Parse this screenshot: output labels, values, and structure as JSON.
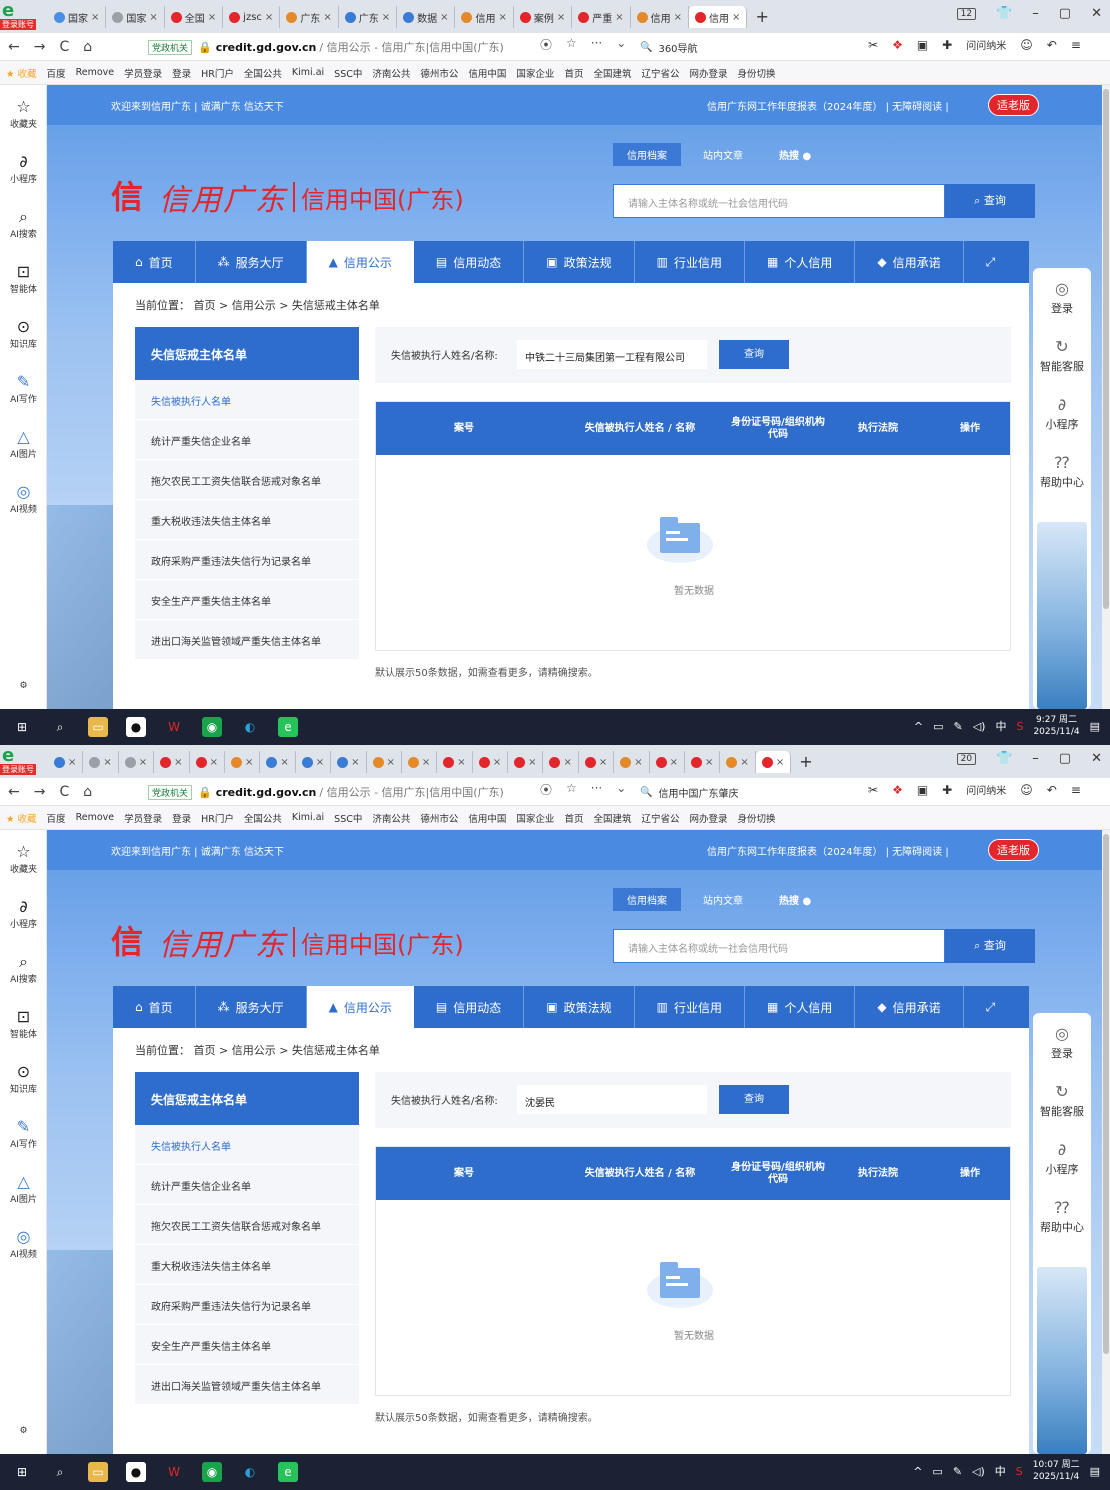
{
  "screenshots": [
    {
      "browser": {
        "logo_icon": "browser-logo",
        "account_badge": "登录账号",
        "tabs": [
          {
            "label": "国家",
            "active": false,
            "color": "#4a90e2"
          },
          {
            "label": "国家",
            "active": false,
            "color": "#9aa0a6"
          },
          {
            "label": "全国",
            "active": false,
            "color": "#e3262b"
          },
          {
            "label": "jzsc",
            "active": false,
            "color": "#e3262b"
          },
          {
            "label": "广东",
            "active": false,
            "color": "#e58a2b"
          },
          {
            "label": "广东",
            "active": false,
            "color": "#3a7bd5"
          },
          {
            "label": "数据",
            "active": false,
            "color": "#3a7bd5"
          },
          {
            "label": "信用",
            "active": false,
            "color": "#e58a2b"
          },
          {
            "label": "案例",
            "active": false,
            "color": "#e3262b"
          },
          {
            "label": "严重",
            "active": false,
            "color": "#e3262b"
          },
          {
            "label": "信用",
            "active": false,
            "color": "#e58a2b"
          },
          {
            "label": "信用",
            "active": true,
            "color": "#e3262b"
          }
        ],
        "new_tab": "+",
        "tab_count": "12",
        "url_org_tag": "党政机关",
        "url_domain": "credit.gd.gov.cn",
        "url_path": "/ 信用公示 - 信用广东|信用中国(广东)",
        "search_text": "360导航",
        "wenwen": "问问纳米",
        "bookmarks": [
          "收藏",
          "百度",
          "Remove",
          "学员登录",
          "登录",
          "HR门户",
          "全国公共",
          "Kimi.ai",
          "SSC中",
          "济南公共",
          "德州市公",
          "信用中国",
          "国家企业",
          "首页",
          "全国建筑",
          "辽宁省公",
          "网办登录",
          "身份切换"
        ]
      },
      "sidebar": [
        {
          "label": "收藏夹",
          "icon": "star-icon"
        },
        {
          "label": "小程序",
          "icon": "miniapp-icon"
        },
        {
          "label": "AI搜索",
          "icon": "search-icon"
        },
        {
          "label": "智能体",
          "icon": "agent-icon"
        },
        {
          "label": "知识库",
          "icon": "knowledge-icon"
        },
        {
          "label": "AI写作",
          "icon": "write-icon"
        },
        {
          "label": "AI图片",
          "icon": "image-icon"
        },
        {
          "label": "AI视频",
          "icon": "video-icon"
        }
      ],
      "site": {
        "welcome": "欢迎来到信用广东 | 诚满广东 信达天下",
        "annual_report": "信用广东网工作年度报表（2024年度） | 无障碍阅读 |",
        "elder_mode": "适老版",
        "logo_script": "信用广东",
        "logo_cn": "信用中国(广东)",
        "search_filters": [
          "信用档案",
          "站内文章",
          "热搜"
        ],
        "search_placeholder": "请输入主体名称或统一社会信用代码",
        "search_button": "查询",
        "nav": [
          "首页",
          "服务大厅",
          "信用公示",
          "信用动态",
          "政策法规",
          "行业信用",
          "个人信用",
          "信用承诺"
        ],
        "breadcrumb": "当前位置：  首页 > 信用公示 > 失信惩戒主体名单",
        "left_menu_title": "失信惩戒主体名单",
        "left_menu": [
          "失信被执行人名单",
          "统计严重失信企业名单",
          "拖欠农民工工资失信联合惩戒对象名单",
          "重大税收违法失信主体名单",
          "政府采购严重违法失信行为记录名单",
          "安全生产严重失信主体名单",
          "进出口海关监管领域严重失信主体名单"
        ],
        "query_label": "失信被执行人姓名/名称:",
        "query_value": "中铁二十三局集团第一工程有限公司",
        "query_button": "查询",
        "table_headers": [
          "案号",
          "失信被执行人姓名 / 名称",
          "身份证号码/组织机构代码",
          "执行法院",
          "操作"
        ],
        "empty_text": "暂无数据",
        "table_note": "默认展示50条数据，如需查看更多，请精确搜索。",
        "float_menu": [
          "登录",
          "智能客服",
          "小程序",
          "帮助中心"
        ]
      },
      "taskbar": {
        "time": "9:27 周二",
        "date": "2025/11/4",
        "ime": "中"
      }
    },
    {
      "browser": {
        "logo_icon": "browser-logo",
        "account_badge": "登录账号",
        "tabs": [
          {
            "label": "",
            "active": false,
            "color": "#3a7bd5"
          },
          {
            "label": "",
            "active": false,
            "color": "#9aa0a6"
          },
          {
            "label": "",
            "active": false,
            "color": "#9aa0a6"
          },
          {
            "label": "",
            "active": false,
            "color": "#e3262b"
          },
          {
            "label": "",
            "active": false,
            "color": "#e3262b"
          },
          {
            "label": "",
            "active": false,
            "color": "#e58a2b"
          },
          {
            "label": "",
            "active": false,
            "color": "#3a7bd5"
          },
          {
            "label": "",
            "active": false,
            "color": "#3a7bd5"
          },
          {
            "label": "",
            "active": false,
            "color": "#3a7bd5"
          },
          {
            "label": "",
            "active": false,
            "color": "#e58a2b"
          },
          {
            "label": "",
            "active": false,
            "color": "#e58a2b"
          },
          {
            "label": "",
            "active": false,
            "color": "#e3262b"
          },
          {
            "label": "",
            "active": false,
            "color": "#e3262b"
          },
          {
            "label": "",
            "active": false,
            "color": "#e3262b"
          },
          {
            "label": "",
            "active": false,
            "color": "#e3262b"
          },
          {
            "label": "",
            "active": false,
            "color": "#e3262b"
          },
          {
            "label": "",
            "active": false,
            "color": "#e58a2b"
          },
          {
            "label": "",
            "active": false,
            "color": "#e3262b"
          },
          {
            "label": "",
            "active": false,
            "color": "#e3262b"
          },
          {
            "label": "",
            "active": false,
            "color": "#e58a2b"
          },
          {
            "label": "",
            "active": true,
            "color": "#e3262b"
          }
        ],
        "new_tab": "+",
        "tab_count": "20",
        "url_org_tag": "党政机关",
        "url_domain": "credit.gd.gov.cn",
        "url_path": "/ 信用公示 - 信用广东|信用中国(广东)",
        "search_text": "信用中国广东肇庆",
        "wenwen": "问问纳米",
        "bookmarks": [
          "收藏",
          "百度",
          "Remove",
          "学员登录",
          "登录",
          "HR门户",
          "全国公共",
          "Kimi.ai",
          "SSC中",
          "济南公共",
          "德州市公",
          "信用中国",
          "国家企业",
          "首页",
          "全国建筑",
          "辽宁省公",
          "网办登录",
          "身份切换"
        ]
      },
      "sidebar": [
        {
          "label": "收藏夹",
          "icon": "star-icon"
        },
        {
          "label": "小程序",
          "icon": "miniapp-icon"
        },
        {
          "label": "AI搜索",
          "icon": "search-icon"
        },
        {
          "label": "智能体",
          "icon": "agent-icon"
        },
        {
          "label": "知识库",
          "icon": "knowledge-icon"
        },
        {
          "label": "AI写作",
          "icon": "write-icon"
        },
        {
          "label": "AI图片",
          "icon": "image-icon"
        },
        {
          "label": "AI视频",
          "icon": "video-icon"
        }
      ],
      "site": {
        "welcome": "欢迎来到信用广东 | 诚满广东 信达天下",
        "annual_report": "信用广东网工作年度报表（2024年度） | 无障碍阅读 |",
        "elder_mode": "适老版",
        "logo_script": "信用广东",
        "logo_cn": "信用中国(广东)",
        "search_filters": [
          "信用档案",
          "站内文章",
          "热搜"
        ],
        "search_placeholder": "请输入主体名称或统一社会信用代码",
        "search_button": "查询",
        "nav": [
          "首页",
          "服务大厅",
          "信用公示",
          "信用动态",
          "政策法规",
          "行业信用",
          "个人信用",
          "信用承诺"
        ],
        "breadcrumb": "当前位置：  首页 > 信用公示 > 失信惩戒主体名单",
        "left_menu_title": "失信惩戒主体名单",
        "left_menu": [
          "失信被执行人名单",
          "统计严重失信企业名单",
          "拖欠农民工工资失信联合惩戒对象名单",
          "重大税收违法失信主体名单",
          "政府采购严重违法失信行为记录名单",
          "安全生产严重失信主体名单",
          "进出口海关监管领域严重失信主体名单"
        ],
        "query_label": "失信被执行人姓名/名称:",
        "query_value": "沈晏民",
        "query_button": "查询",
        "table_headers": [
          "案号",
          "失信被执行人姓名 / 名称",
          "身份证号码/组织机构代码",
          "执行法院",
          "操作"
        ],
        "empty_text": "暂无数据",
        "table_note": "默认展示50条数据，如需查看更多，请精确搜索。",
        "float_menu": [
          "登录",
          "智能客服",
          "小程序",
          "帮助中心"
        ]
      },
      "taskbar": {
        "time": "10:07 周二",
        "date": "2025/11/4",
        "ime": "中"
      }
    }
  ]
}
